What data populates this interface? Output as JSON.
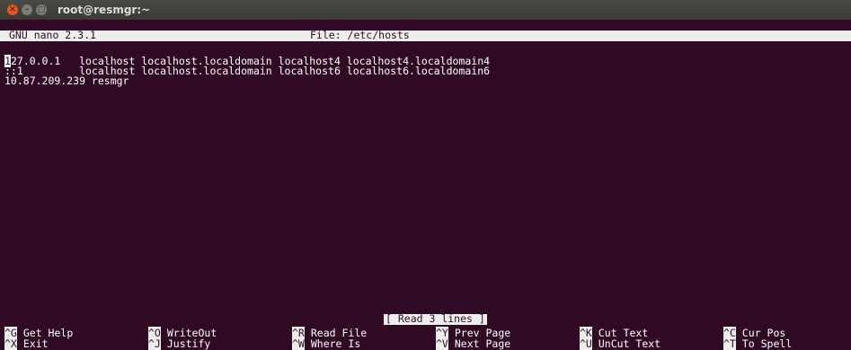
{
  "window": {
    "title": "root@resmgr:~"
  },
  "nano": {
    "version": "GNU nano 2.3.1",
    "file_label": "File: /etc/hosts",
    "lines": [
      "127.0.0.1   localhost localhost.localdomain localhost4 localhost4.localdomain4",
      "::1         localhost localhost.localdomain localhost6 localhost6.localdomain6",
      "10.87.209.239 resmgr"
    ],
    "status": "[ Read 3 lines ]",
    "shortcuts": [
      {
        "key": "^G",
        "label": "Get Help"
      },
      {
        "key": "^O",
        "label": "WriteOut"
      },
      {
        "key": "^R",
        "label": "Read File"
      },
      {
        "key": "^Y",
        "label": "Prev Page"
      },
      {
        "key": "^K",
        "label": "Cut Text"
      },
      {
        "key": "^C",
        "label": "Cur Pos"
      },
      {
        "key": "^X",
        "label": "Exit"
      },
      {
        "key": "^J",
        "label": "Justify"
      },
      {
        "key": "^W",
        "label": "Where Is"
      },
      {
        "key": "^V",
        "label": "Next Page"
      },
      {
        "key": "^U",
        "label": "UnCut Text"
      },
      {
        "key": "^T",
        "label": "To Spell"
      }
    ]
  },
  "colors": {
    "terminal_bg": "#300a24",
    "close_button": "#e95420",
    "bar_bg": "#eeeeec"
  }
}
